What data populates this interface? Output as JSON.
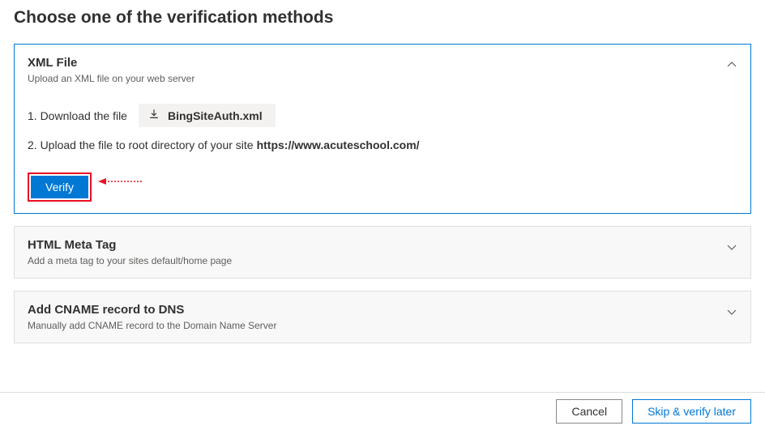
{
  "page": {
    "title": "Choose one of the verification methods"
  },
  "methods": {
    "xml": {
      "title": "XML File",
      "subtitle": "Upload an XML file on your web server",
      "step1_label": "1. Download the file",
      "download_file": "BingSiteAuth.xml",
      "step2_label": "2. Upload the file to root directory of your site",
      "step2_url": "https://www.acuteschool.com/",
      "verify_label": "Verify"
    },
    "meta": {
      "title": "HTML Meta Tag",
      "subtitle": "Add a meta tag to your sites default/home page"
    },
    "cname": {
      "title": "Add CNAME record to DNS",
      "subtitle": "Manually add CNAME record to the Domain Name Server"
    }
  },
  "footer": {
    "cancel": "Cancel",
    "skip": "Skip & verify later"
  }
}
